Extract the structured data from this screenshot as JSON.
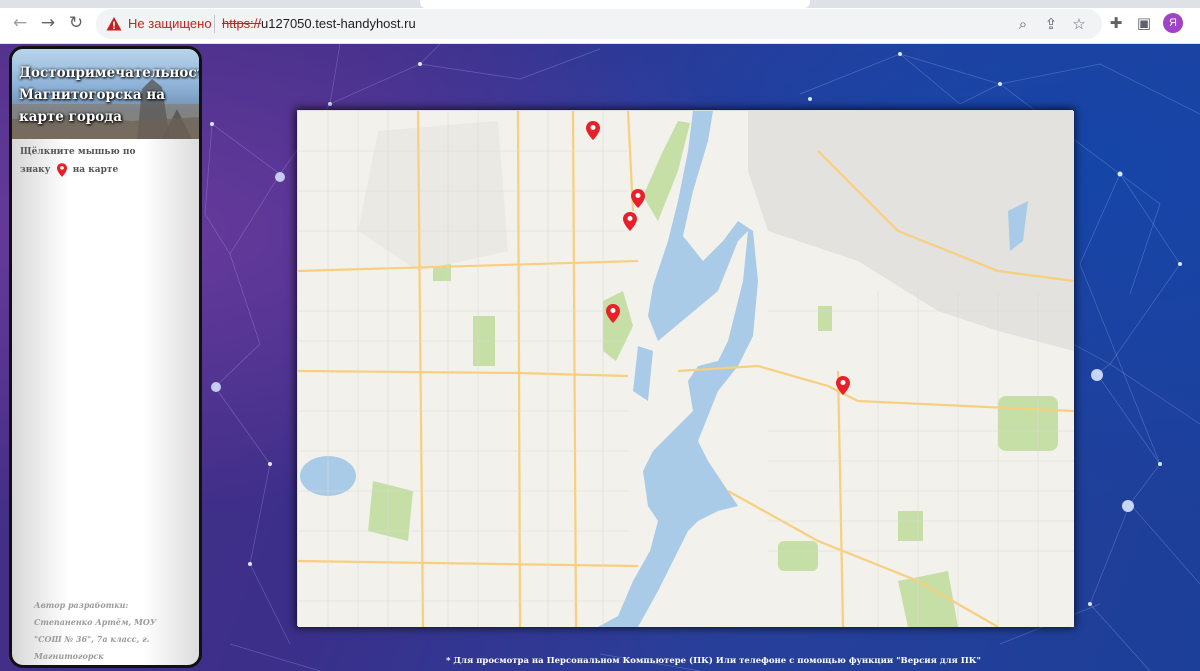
{
  "browser": {
    "security_label": "Не защищено",
    "url_scheme": "https://",
    "url_host": "u127050.test-handyhost.ru",
    "profile_initial": "Я"
  },
  "sidebar": {
    "title": "Достопримечательности Магнитогорска на карте города",
    "hint_before": "Щёлкните мышью по знаку",
    "hint_after": "на карте",
    "author": "Автор разработки: Степаненко Артём, МОУ \"СОШ № 36\", 7а класс, г. Магнитогорск"
  },
  "map": {
    "markers": [
      {
        "name": "landmark-1"
      },
      {
        "name": "landmark-2"
      },
      {
        "name": "landmark-3"
      },
      {
        "name": "landmark-4"
      },
      {
        "name": "landmark-5"
      }
    ]
  },
  "footer": {
    "note": "* Для просмотра на Персональном Компьютере (ПК) Или телефоне с помощью функции \"Версия для ПК\""
  },
  "colors": {
    "marker": "#e8202a",
    "water": "#a9cbe8",
    "park": "#c6dfa6"
  }
}
